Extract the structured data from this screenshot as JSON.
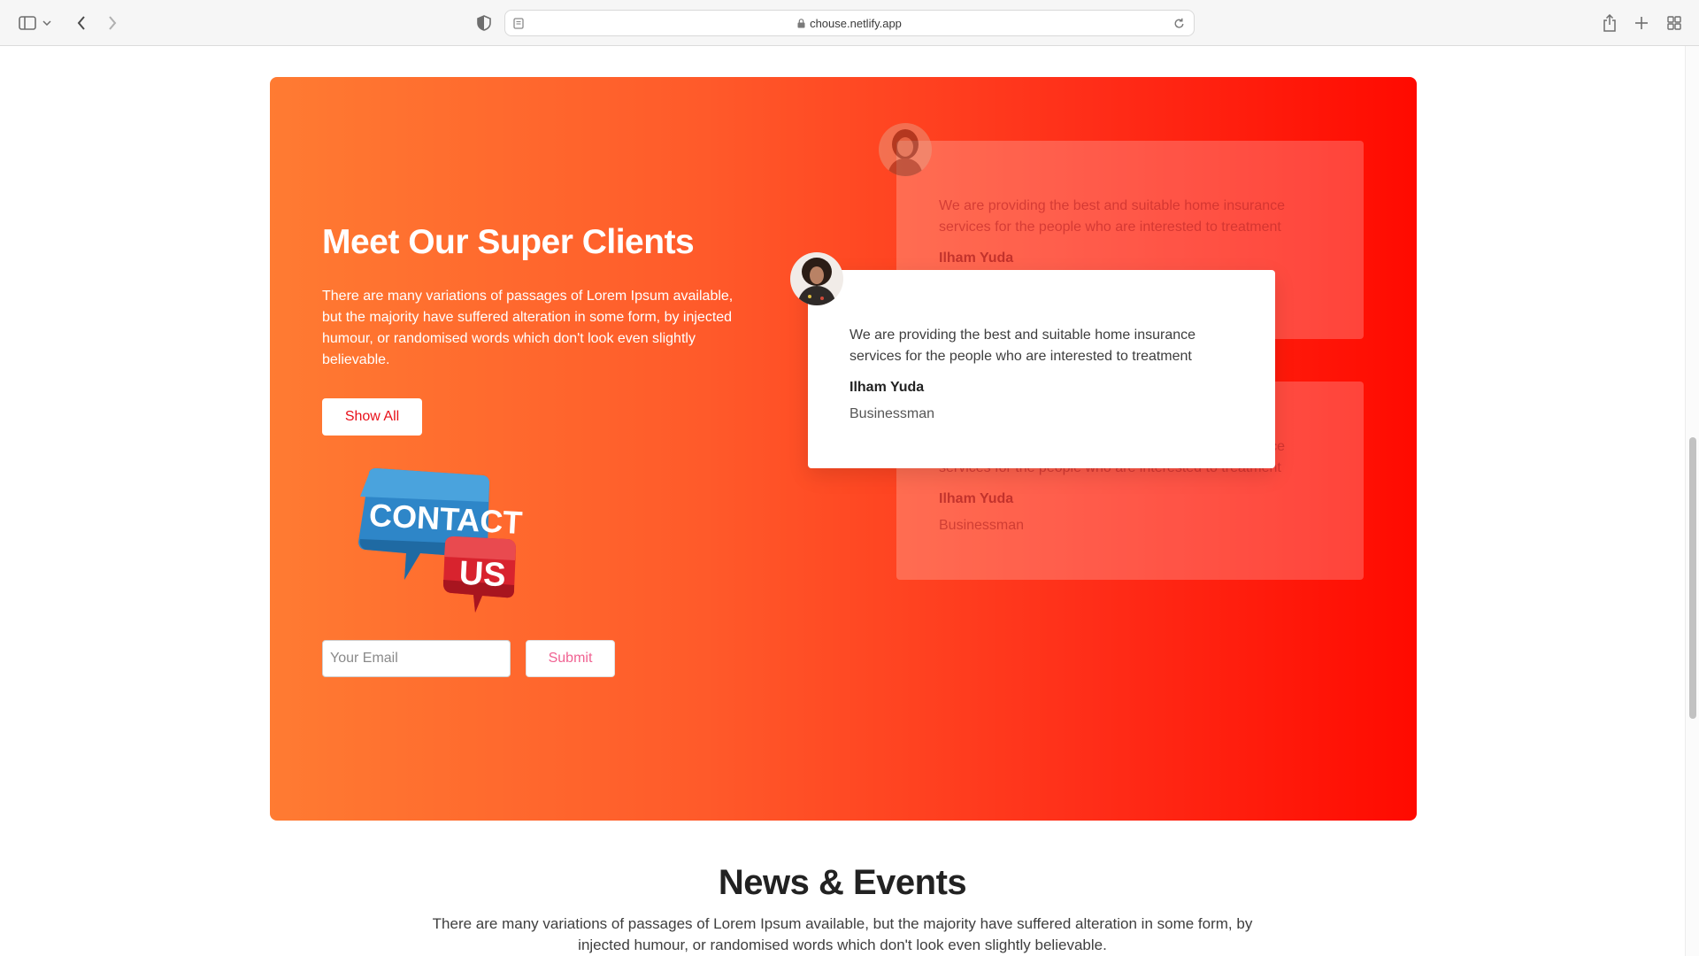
{
  "browser": {
    "url": "chouse.netlify.app",
    "icons": [
      "sidebar-icon",
      "chevron-down-icon",
      "back-icon",
      "forward-icon",
      "shield-icon",
      "page-icon",
      "lock-icon",
      "reload-icon",
      "share-icon",
      "plus-icon",
      "tabs-grid-icon"
    ]
  },
  "hero": {
    "title": "Meet Our Super Clients",
    "text": "There are many variations of passages of Lorem Ipsum available, but the majority have suffered alteration in some form, by injected humour, or randomised words which don't look even slightly believable.",
    "show_all_label": "Show All",
    "contact_image": {
      "line1": "CONTACT",
      "line2": "US"
    },
    "email_placeholder": "Your Email",
    "submit_label": "Submit",
    "colors": {
      "gradient_start": "#ff7b32",
      "gradient_end": "#ff0a00",
      "button_text": "#e8101a",
      "submit_text": "#f06292"
    }
  },
  "testimonials": {
    "ghost_top": {
      "quote": "We are providing the best and suitable home insurance services for the people who are interested to treatment",
      "name": "Ilham Yuda"
    },
    "main": {
      "quote": "We are providing the best and suitable home insurance services for the people who are interested to treatment",
      "name": "Ilham Yuda",
      "role": "Businessman"
    },
    "ghost_bottom": {
      "quote": "We are providing the best and suitable home insurance services for the people who are interested to treatment",
      "name": "Ilham Yuda",
      "role": "Businessman"
    }
  },
  "news": {
    "title": "News & Events",
    "text": "There are many variations of passages of Lorem Ipsum available, but the majority have suffered alteration in some form, by injected humour, or randomised words which don't look even slightly believable."
  }
}
